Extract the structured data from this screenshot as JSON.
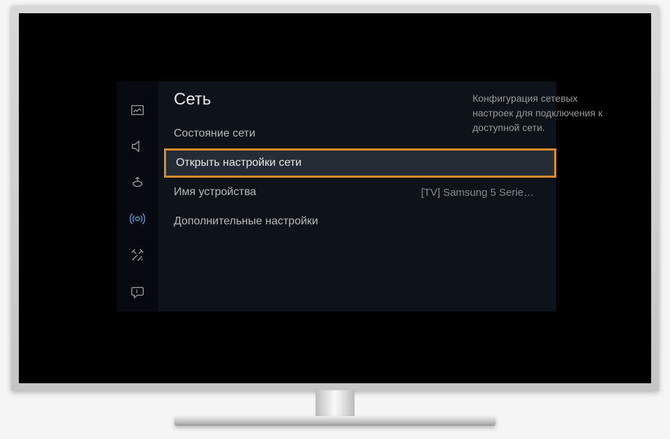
{
  "section_title": "Сеть",
  "menu": {
    "items": [
      {
        "label": "Состояние сети",
        "value": ""
      },
      {
        "label": "Открыть настройки сети",
        "value": ""
      },
      {
        "label": "Имя устройства",
        "value": "[TV] Samsung 5 Serie…"
      },
      {
        "label": "Дополнительные настройки",
        "value": ""
      }
    ],
    "highlighted_index": 1
  },
  "description": "Конфигурация сетевых настроек для подключения к доступной сети.",
  "sidebar": {
    "active_index": 3,
    "icons": [
      "picture",
      "sound",
      "broadcast",
      "network",
      "tools",
      "support"
    ]
  }
}
